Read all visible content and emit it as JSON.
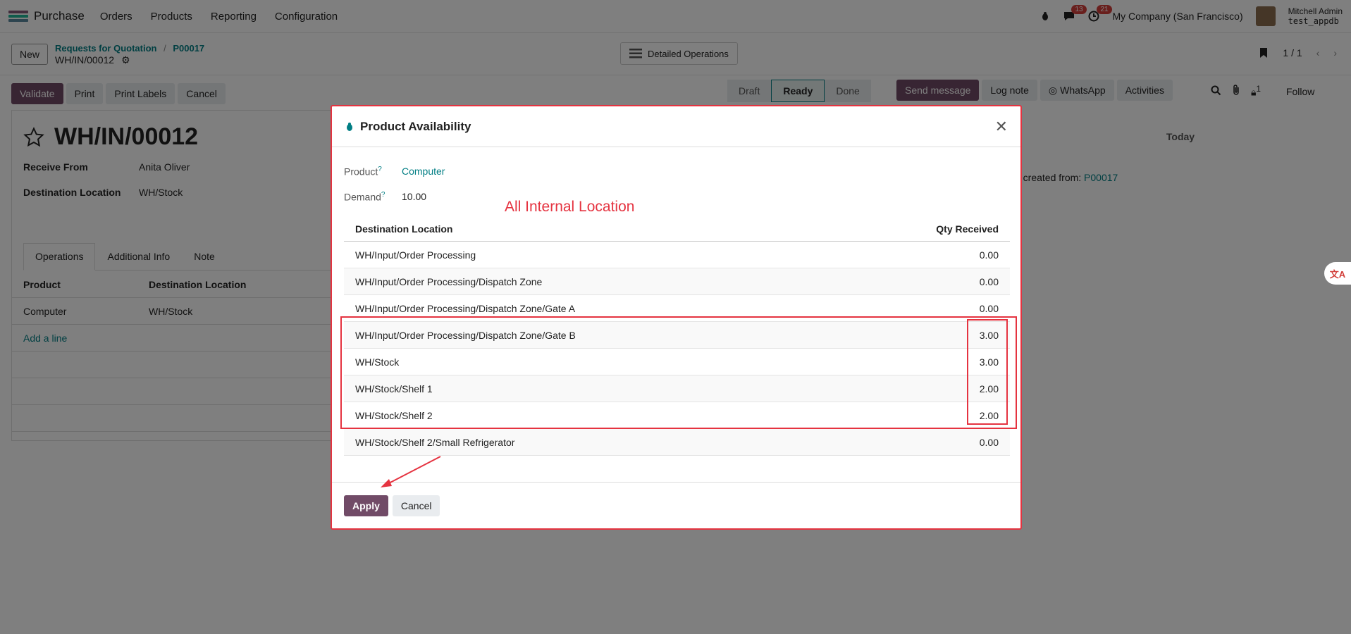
{
  "nav": {
    "app_name": "Purchase",
    "menu": [
      "Orders",
      "Products",
      "Reporting",
      "Configuration"
    ],
    "chat_badge": "13",
    "activity_badge": "21",
    "company": "My Company (San Francisco)",
    "user_name": "Mitchell Admin",
    "user_db": "test_appdb"
  },
  "control_panel": {
    "new_label": "New",
    "breadcrumb_parent": "Requests for Quotation",
    "breadcrumb_sep": "/",
    "breadcrumb_current": "P00017",
    "record_ref": "WH/IN/00012",
    "detailed_ops_label": "Detailed Operations",
    "pager": "1 / 1"
  },
  "actions": {
    "validate": "Validate",
    "print": "Print",
    "print_labels": "Print Labels",
    "cancel": "Cancel"
  },
  "status": [
    "Draft",
    "Ready",
    "Done"
  ],
  "chatter": {
    "send_message": "Send message",
    "log_note": "Log note",
    "whatsapp": "WhatsApp",
    "activities": "Activities",
    "follow": "Follow",
    "follower_count": "1",
    "today": "Today",
    "msg_text": "n created from:",
    "msg_link": "P00017"
  },
  "record": {
    "title": "WH/IN/00012",
    "receive_from_label": "Receive From",
    "receive_from_value": "Anita Oliver",
    "dest_label": "Destination Location",
    "dest_value": "WH/Stock",
    "tabs": [
      "Operations",
      "Additional Info",
      "Note"
    ],
    "col_product": "Product",
    "col_dest": "Destination Location",
    "line_product": "Computer",
    "line_dest": "WH/Stock",
    "add_line": "Add a line"
  },
  "modal": {
    "title": "Product Availability",
    "product_label": "Product",
    "product_value": "Computer",
    "demand_label": "Demand",
    "demand_value": "10.00",
    "annotation": "All Internal Location",
    "col_location": "Destination Location",
    "col_qty": "Qty Received",
    "rows": [
      {
        "location": "WH/Input/Order Processing",
        "qty": "0.00"
      },
      {
        "location": "WH/Input/Order Processing/Dispatch Zone",
        "qty": "0.00"
      },
      {
        "location": "WH/Input/Order Processing/Dispatch Zone/Gate A",
        "qty": "0.00"
      },
      {
        "location": "WH/Input/Order Processing/Dispatch Zone/Gate B",
        "qty": "3.00"
      },
      {
        "location": "WH/Stock",
        "qty": "3.00"
      },
      {
        "location": "WH/Stock/Shelf 1",
        "qty": "2.00"
      },
      {
        "location": "WH/Stock/Shelf 2",
        "qty": "2.00"
      },
      {
        "location": "WH/Stock/Shelf 2/Small Refrigerator",
        "qty": "0.00"
      }
    ],
    "apply": "Apply",
    "cancel": "Cancel"
  },
  "colors": {
    "brand": "#714b67",
    "link": "#017e84",
    "annotation_red": "#e53340"
  }
}
